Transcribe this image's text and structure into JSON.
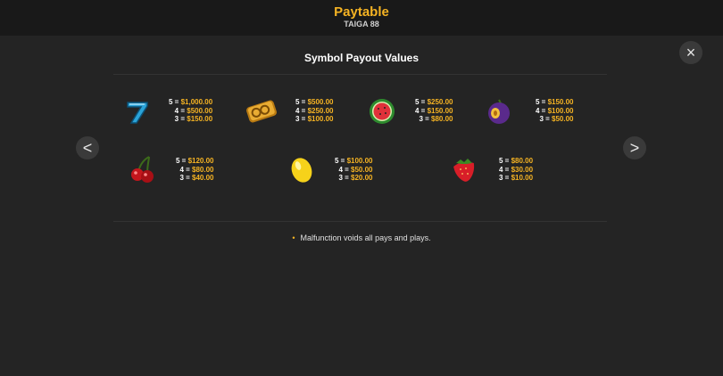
{
  "header": {
    "title": "Paytable",
    "subtitle": "TAIGA 88"
  },
  "close_icon": "×",
  "nav": {
    "prev_icon": "<",
    "next_icon": ">"
  },
  "section_title": "Symbol Payout Values",
  "symbols": [
    {
      "icon": "seven-icon",
      "pays": [
        {
          "k": "5",
          "v": "$1,000.00"
        },
        {
          "k": "4",
          "v": "$500.00"
        },
        {
          "k": "3",
          "v": "$150.00"
        }
      ]
    },
    {
      "icon": "gold-88-icon",
      "pays": [
        {
          "k": "5",
          "v": "$500.00"
        },
        {
          "k": "4",
          "v": "$250.00"
        },
        {
          "k": "3",
          "v": "$100.00"
        }
      ]
    },
    {
      "icon": "watermelon-icon",
      "pays": [
        {
          "k": "5",
          "v": "$250.00"
        },
        {
          "k": "4",
          "v": "$150.00"
        },
        {
          "k": "3",
          "v": "$80.00"
        }
      ]
    },
    {
      "icon": "plum-icon",
      "pays": [
        {
          "k": "5",
          "v": "$150.00"
        },
        {
          "k": "4",
          "v": "$100.00"
        },
        {
          "k": "3",
          "v": "$50.00"
        }
      ]
    },
    {
      "icon": "cherries-icon",
      "pays": [
        {
          "k": "5",
          "v": "$120.00"
        },
        {
          "k": "4",
          "v": "$80.00"
        },
        {
          "k": "3",
          "v": "$40.00"
        }
      ]
    },
    {
      "icon": "lemon-icon",
      "pays": [
        {
          "k": "5",
          "v": "$100.00"
        },
        {
          "k": "4",
          "v": "$50.00"
        },
        {
          "k": "3",
          "v": "$20.00"
        }
      ]
    },
    {
      "icon": "strawberry-icon",
      "pays": [
        {
          "k": "5",
          "v": "$80.00"
        },
        {
          "k": "4",
          "v": "$30.00"
        },
        {
          "k": "3",
          "v": "$10.00"
        }
      ]
    }
  ],
  "separator": " = ",
  "note": "Malfunction voids all pays and plays.",
  "colors": {
    "accent": "#f5b323",
    "background": "#242424",
    "header": "#191919"
  }
}
